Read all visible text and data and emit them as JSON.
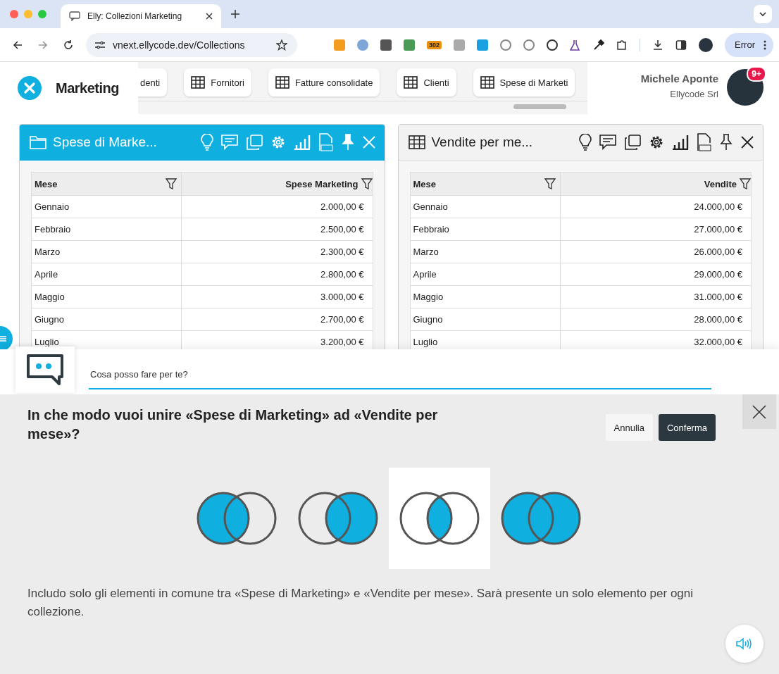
{
  "browser": {
    "tab_title": "Elly: Collezioni Marketing",
    "url": "vnext.ellycode.dev/Collections",
    "extension_badge": "302",
    "profile_button": "Error"
  },
  "app": {
    "title": "Marketing",
    "collection_tabs": [
      {
        "label": "denti",
        "kind": "cut"
      },
      {
        "label": "Fornitori",
        "kind": "table"
      },
      {
        "label": "Fatture consolidate",
        "kind": "table"
      },
      {
        "label": "Clienti",
        "kind": "table"
      },
      {
        "label": "Spese di Marketi",
        "kind": "table"
      }
    ],
    "user": {
      "name": "Michele Aponte",
      "company": "Ellycode Srl",
      "notifications": "9+"
    }
  },
  "panels": [
    {
      "title": "Spese di Marke...",
      "kind": "folder",
      "active": true,
      "columns": [
        "Mese",
        "Spese Marketing"
      ],
      "rows": [
        [
          "Gennaio",
          "2.000,00 €"
        ],
        [
          "Febbraio",
          "2.500,00 €"
        ],
        [
          "Marzo",
          "2.300,00 €"
        ],
        [
          "Aprile",
          "2.800,00 €"
        ],
        [
          "Maggio",
          "3.000,00 €"
        ],
        [
          "Giugno",
          "2.700,00 €"
        ],
        [
          "Luglio",
          "3.200,00 €"
        ]
      ]
    },
    {
      "title": "Vendite per me...",
      "kind": "table",
      "active": false,
      "columns": [
        "Mese",
        "Vendite"
      ],
      "rows": [
        [
          "Gennaio",
          "24.000,00 €"
        ],
        [
          "Febbraio",
          "27.000,00 €"
        ],
        [
          "Marzo",
          "26.000,00 €"
        ],
        [
          "Aprile",
          "29.000,00 €"
        ],
        [
          "Maggio",
          "31.000,00 €"
        ],
        [
          "Giugno",
          "28.000,00 €"
        ],
        [
          "Luglio",
          "32.000,00 €"
        ]
      ]
    }
  ],
  "chat": {
    "placeholder": "Cosa posso fare per te?"
  },
  "join_dialog": {
    "question": "In che modo vuoi unire «Spese di Marketing» ad «Vendite per mese»?",
    "buttons": [
      "Annulla",
      "Conferma"
    ],
    "options": [
      {
        "kind": "left",
        "selected": false
      },
      {
        "kind": "right",
        "selected": false
      },
      {
        "kind": "inner",
        "selected": true
      },
      {
        "kind": "full",
        "selected": false
      }
    ],
    "description": "Includo solo gli elementi in comune tra «Spese di Marketing» e «Vendite per mese». Sarà presente un solo elemento per ogni collezione."
  }
}
